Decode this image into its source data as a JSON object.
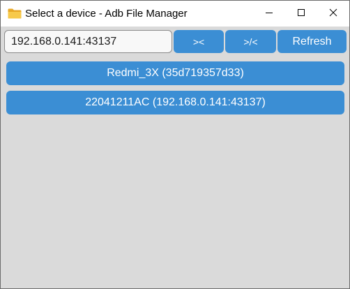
{
  "window": {
    "title": "Select a device - Adb File Manager",
    "icon": "folder-icon",
    "controls": [
      "minimize-icon",
      "maximize-icon",
      "close-icon"
    ]
  },
  "toolbar": {
    "address_value": "192.168.0.141:43137",
    "connect_label": "><",
    "disconnect_label": ">/<",
    "refresh_label": "Refresh"
  },
  "devices": [
    {
      "label": "Redmi_3X (35d719357d33)"
    },
    {
      "label": "22041211AC (192.168.0.141:43137)"
    }
  ],
  "colors": {
    "accent": "#3b8ed4",
    "background": "#dadada",
    "titlebar": "#ffffff"
  }
}
